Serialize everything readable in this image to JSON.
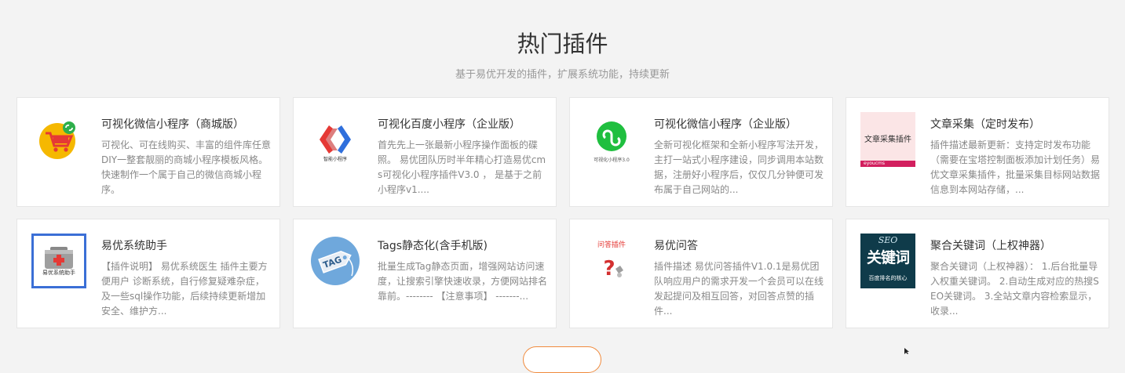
{
  "section": {
    "title": "热门插件",
    "subtitle": "基于易优开发的插件，扩展系统功能，持续更新"
  },
  "plugins": [
    {
      "name": "可视化微信小程序（商城版）",
      "desc": "可视化、可在线购买、丰富的组件库任意DIY一整套靓丽的商城小程序模板风格。快速制作一个属于自己的微信商城小程序。",
      "icon": "shopping-cart-icon"
    },
    {
      "name": "可视化百度小程序（企业版）",
      "desc": "首先先上一张最新小程序操作面板的碟照。 易优团队历时半年精心打造易优cms可视化小程序插件V3.0 ， 是基于之前小程序v1....",
      "icon": "baidu-miniprogram-icon",
      "thumb_label": "智能小程序"
    },
    {
      "name": "可视化微信小程序（企业版）",
      "desc": "全新可视化框架和全新小程序写法开发，主打一站式小程序建设，同步调用本站数据，注册好小程序后，仅仅几分钟便可发布属于自己网站的...",
      "icon": "wechat-miniprogram-icon",
      "thumb_label": "可视化小程序3.0"
    },
    {
      "name": "文章采集（定时发布）",
      "desc": "插件描述最新更新：支持定时发布功能（需要在宝塔控制面板添加计划任务）易优文章采集插件，批量采集目标网站数据信息到本网站存储，...",
      "icon": "article-collect-icon",
      "thumb_label": "文章采集插件",
      "thumb_footer": "eyoucms"
    },
    {
      "name": "易优系统助手",
      "desc": "【插件说明】 易优系统医生 插件主要方便用户 诊断系统，自行修复疑难杂症，及一些sql操作功能，后续持续更新增加安全、维护方...",
      "icon": "first-aid-kit-icon",
      "thumb_label": "易优系统助手"
    },
    {
      "name": "Tags静态化(含手机版)",
      "desc": "批量生成Tag静态页面，增强网站访问速度，让搜索引擎快速收录，方便网站排名靠前。-------- 【注意事项】 -------...",
      "icon": "tag-icon",
      "thumb_label": "TAG"
    },
    {
      "name": "易优问答",
      "desc": "插件描述 易优问答插件V1.0.1是易优团队响应用户的需求开发一个会员可以在线发起提问及相互回答，对回答点赞的插件...",
      "icon": "question-mark-icon",
      "thumb_label": "问答插件"
    },
    {
      "name": "聚合关键词（上权神器）",
      "desc": "聚合关键词（上权神器）： 1.后台批量导入权重关键词。 2.自动生成对应的热搜SEO关键词。 3.全站文章内容检索显示，收录...",
      "icon": "seo-keyword-icon",
      "thumb_seo": "SEO",
      "thumb_big": "关键词",
      "thumb_small": "百度排名的核心"
    }
  ],
  "colors": {
    "accent": "#f08a3c",
    "background": "#f3f3f3"
  }
}
